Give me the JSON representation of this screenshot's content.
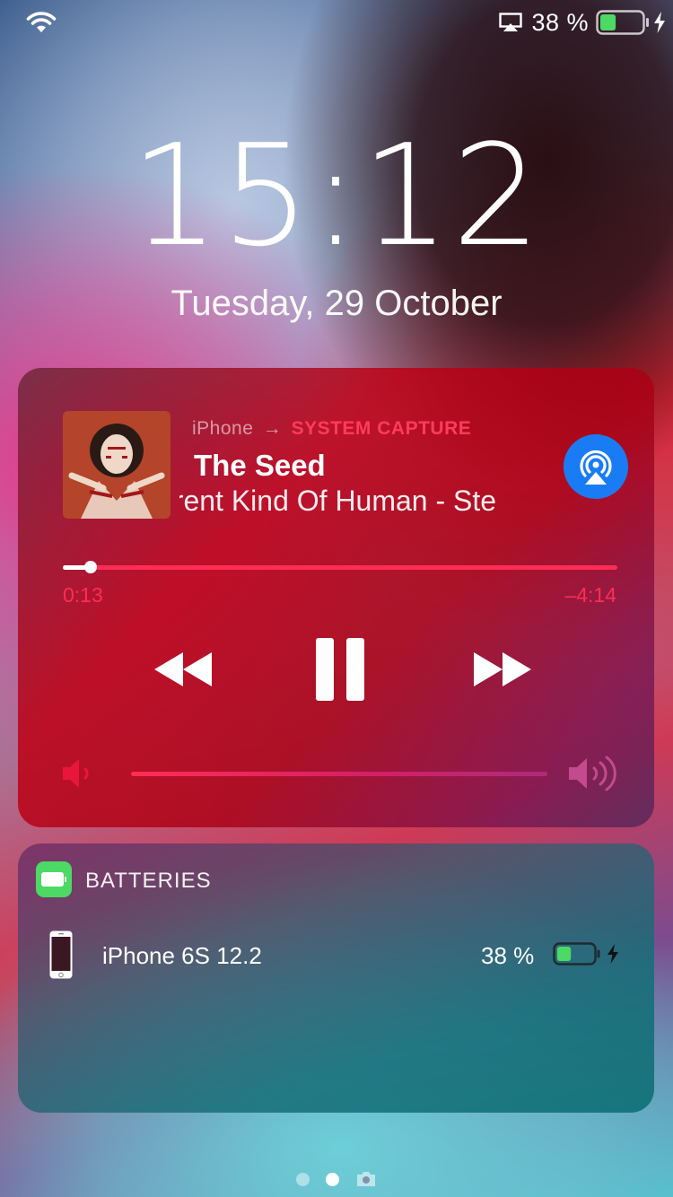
{
  "status_bar": {
    "battery_percent_text": "38 %",
    "battery_level": 0.38,
    "charging": true
  },
  "lock_screen": {
    "time": "15:12",
    "date": "Tuesday, 29 October"
  },
  "now_playing": {
    "source_device": "iPhone",
    "source_arrow": "→",
    "source_target": "SYSTEM CAPTURE",
    "title": "The Seed",
    "subtitle": "erent Kind Of Human - Ste",
    "elapsed": "0:13",
    "remaining": "–4:14",
    "progress": 0.05,
    "volume": 1.0,
    "accent_color": "#ff2d55",
    "airplay_color": "#1a7cf5"
  },
  "batteries_widget": {
    "title": "BATTERIES",
    "devices": [
      {
        "name": "iPhone 6S 12.2",
        "percent_text": "38 %",
        "level": 0.38,
        "charging": true
      }
    ]
  },
  "pager": {
    "pages": 2,
    "active_index": 1
  }
}
